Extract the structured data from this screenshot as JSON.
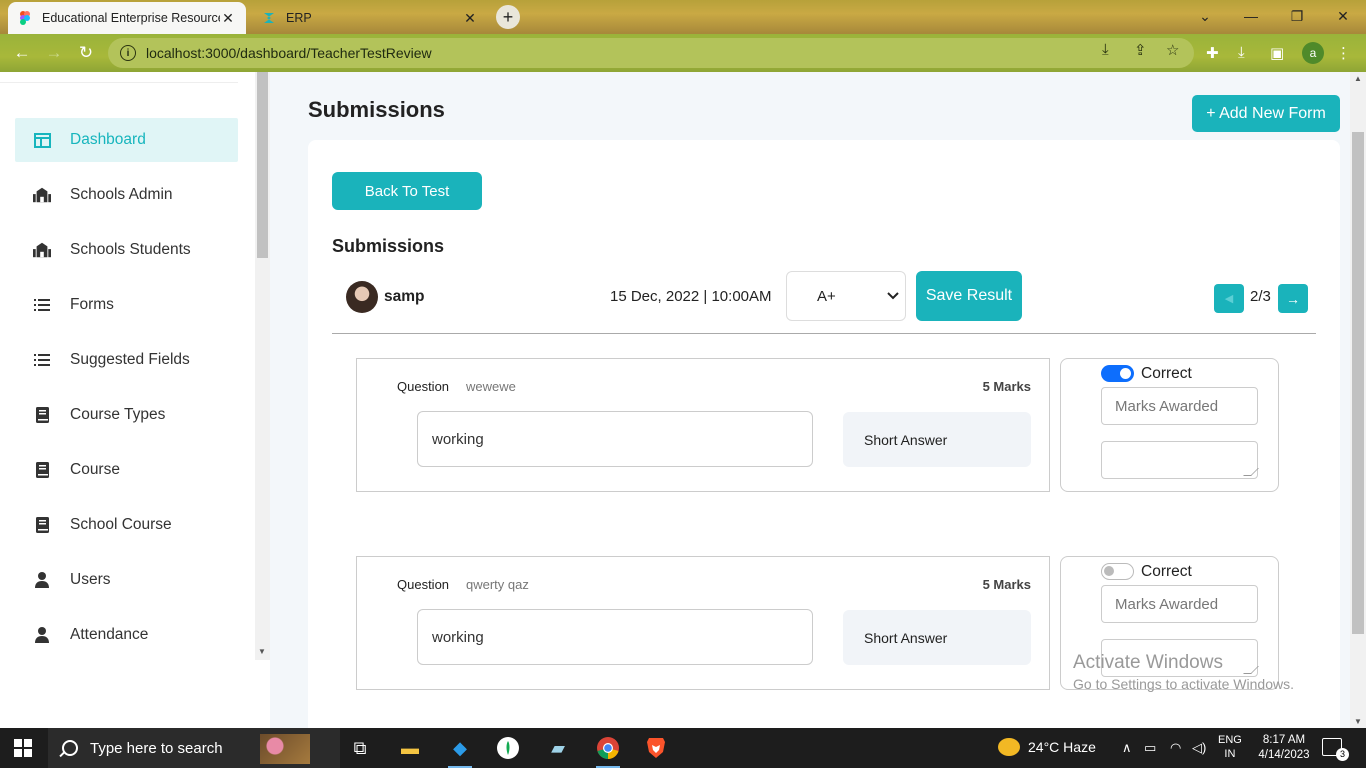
{
  "browser": {
    "tabs": [
      {
        "title": "Educational Enterprise Resource P",
        "active": true
      },
      {
        "title": "ERP",
        "active": false
      }
    ],
    "url": "localhost:3000/dashboard/TeacherTestReview",
    "profile_initial": "a"
  },
  "sidebar": {
    "items": [
      {
        "label": "Dashboard",
        "icon": "dashboard-icon",
        "active": true
      },
      {
        "label": "Schools Admin",
        "icon": "school-icon"
      },
      {
        "label": "Schools Students",
        "icon": "school-icon"
      },
      {
        "label": "Forms",
        "icon": "list-icon"
      },
      {
        "label": "Suggested Fields",
        "icon": "list-icon"
      },
      {
        "label": "Course Types",
        "icon": "book-icon"
      },
      {
        "label": "Course",
        "icon": "book-icon"
      },
      {
        "label": "School Course",
        "icon": "book-icon"
      },
      {
        "label": "Users",
        "icon": "user-icon"
      },
      {
        "label": "Attendance",
        "icon": "user-icon"
      }
    ]
  },
  "main": {
    "title": "Submissions",
    "add_button": "+ Add New Form",
    "back_button": "Back To Test",
    "section_title": "Submissions",
    "student_name": "samp",
    "submitted_at": "15 Dec, 2022 | 10:00AM",
    "grade": "A+",
    "save_button": "Save Result",
    "pager": "2/3",
    "questions": [
      {
        "label": "Question",
        "text": "wewewe",
        "marks": "5 Marks",
        "answer": "working",
        "type": "Short Answer",
        "correct": true,
        "correct_label": "Correct",
        "marks_placeholder": "Marks Awarded"
      },
      {
        "label": "Question",
        "text": "qwerty qaz",
        "marks": "5 Marks",
        "answer": "working",
        "type": "Short Answer",
        "correct": false,
        "correct_label": "Correct",
        "marks_placeholder": "Marks Awarded"
      }
    ]
  },
  "watermark": {
    "line1": "Activate Windows",
    "line2": "Go to Settings to activate Windows."
  },
  "taskbar": {
    "search_placeholder": "Type here to search",
    "weather": "24°C  Haze",
    "lang_line1": "ENG",
    "lang_line2": "IN",
    "time": "8:17 AM",
    "date": "4/14/2023",
    "notifications": "3"
  }
}
